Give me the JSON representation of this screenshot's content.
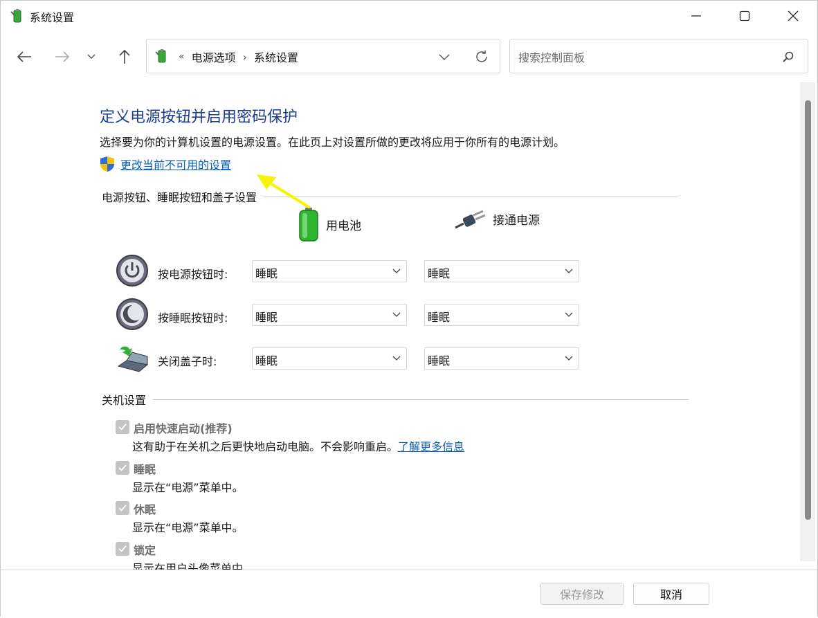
{
  "window": {
    "title": "系统设置"
  },
  "nav": {
    "breadcrumb_sep": "«",
    "crumbs": [
      "电源选项",
      "系统设置"
    ],
    "crumb_arrow": "›",
    "search_placeholder": "搜索控制面板"
  },
  "main": {
    "heading": "定义电源按钮并启用密码保护",
    "description": "选择要为你的计算机设置的电源设置。在此页上对设置所做的更改将应用于你所有的电源计划。",
    "change_link": "更改当前不可用的设置",
    "section_buttons": "电源按钮、睡眠按钮和盖子设置",
    "col_battery": "用电池",
    "col_plugged": "接通电源",
    "rows": [
      {
        "label": "按电源按钮时:",
        "battery": "睡眠",
        "plugged": "睡眠"
      },
      {
        "label": "按睡眠按钮时:",
        "battery": "睡眠",
        "plugged": "睡眠"
      },
      {
        "label": "关闭盖子时:",
        "battery": "睡眠",
        "plugged": "睡眠"
      }
    ],
    "section_shutdown": "关机设置",
    "shutdown": [
      {
        "title": "启用快速启动(推荐)",
        "desc": "这有助于在关机之后更快地启动电脑。不会影响重启。",
        "link": "了解更多信息"
      },
      {
        "title": "睡眠",
        "desc": "显示在“电源”菜单中。"
      },
      {
        "title": "休眠",
        "desc": "显示在“电源”菜单中。"
      },
      {
        "title": "锁定",
        "desc": "显示在用户头像菜单中。"
      }
    ]
  },
  "footer": {
    "save": "保存修改",
    "cancel": "取消"
  },
  "colors": {
    "heading": "#1a3e8c",
    "link": "#0a5fbf",
    "arrow": "#f5f500"
  }
}
